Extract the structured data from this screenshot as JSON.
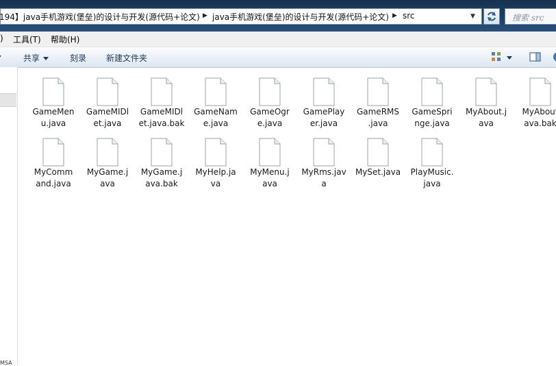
{
  "address_bar": {
    "segments": [
      "194】java手机游戏(堡垒)的设计与开发(源代码+论文)",
      "java手机游戏(堡垒)的设计与开发(源代码+论文)",
      "src"
    ]
  },
  "search": {
    "placeholder": "搜索 src"
  },
  "menu": {
    "partial": ")",
    "tools": "工具(T)",
    "help": "帮助(H)"
  },
  "commands": {
    "share": "共享",
    "burn": "刻录",
    "new_folder": "新建文件夹"
  },
  "nav": {
    "bottom_text": "MSA"
  },
  "files": [
    "GameMen\nu.java",
    "GameMIDl\net.java",
    "GameMIDl\net.java.bak",
    "GameNam\ne.java",
    "GameOgr\ne.java",
    "GamePlay\ner.java",
    "GameRMS\n.java",
    "GameSpri\nnge.java",
    "MyAbout.j\nava",
    "MyAbout\nava.bak",
    "MyComm\nand.java",
    "MyGame.j\nava",
    "MyGame.j\nava.bak",
    "MyHelp.ja\nva",
    "MyMenu.j\nava",
    "MyRms.jav\na",
    "MySet.java",
    "PlayMusic.\njava"
  ]
}
